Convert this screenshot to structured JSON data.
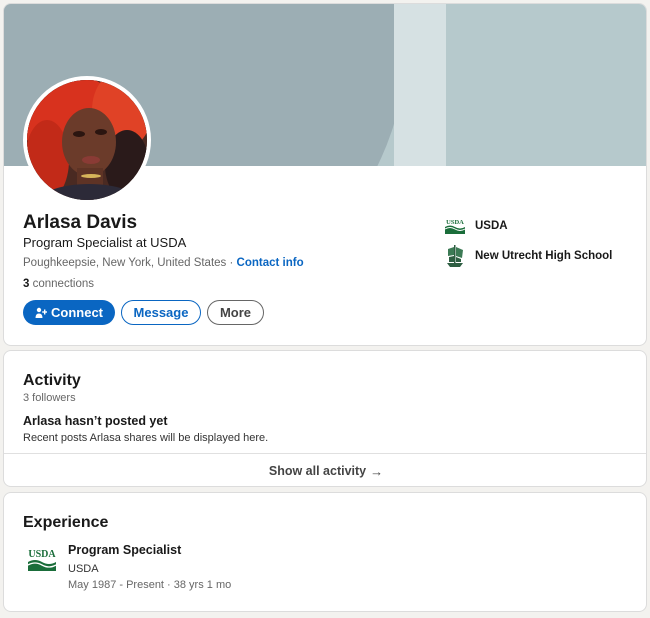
{
  "profile": {
    "name": "Arlasa Davis",
    "headline": "Program Specialist at USDA",
    "location": "Poughkeepsie, New York, United States",
    "separator": "·",
    "contact_info": "Contact info",
    "connections_count": "3",
    "connections_label": "connections",
    "buttons": {
      "connect": "Connect",
      "message": "Message",
      "more": "More"
    },
    "side": {
      "company": "USDA",
      "school": "New Utrecht High School"
    }
  },
  "activity": {
    "title": "Activity",
    "followers": "3 followers",
    "empty_title": "Arlasa hasn’t posted yet",
    "empty_subtitle": "Recent posts Arlasa shares will be displayed here.",
    "show_all": "Show all activity",
    "show_all_icon": "arrow-right-icon"
  },
  "experience": {
    "title": "Experience",
    "items": [
      {
        "role": "Program Specialist",
        "company": "USDA",
        "dates": "May 1987 - Present · 38 yrs 1 mo",
        "logo_text": "USDA"
      }
    ]
  },
  "colors": {
    "accent": "#0a66c2",
    "usda_green": "#1a6d3a",
    "banner": "#b6c9cc"
  }
}
